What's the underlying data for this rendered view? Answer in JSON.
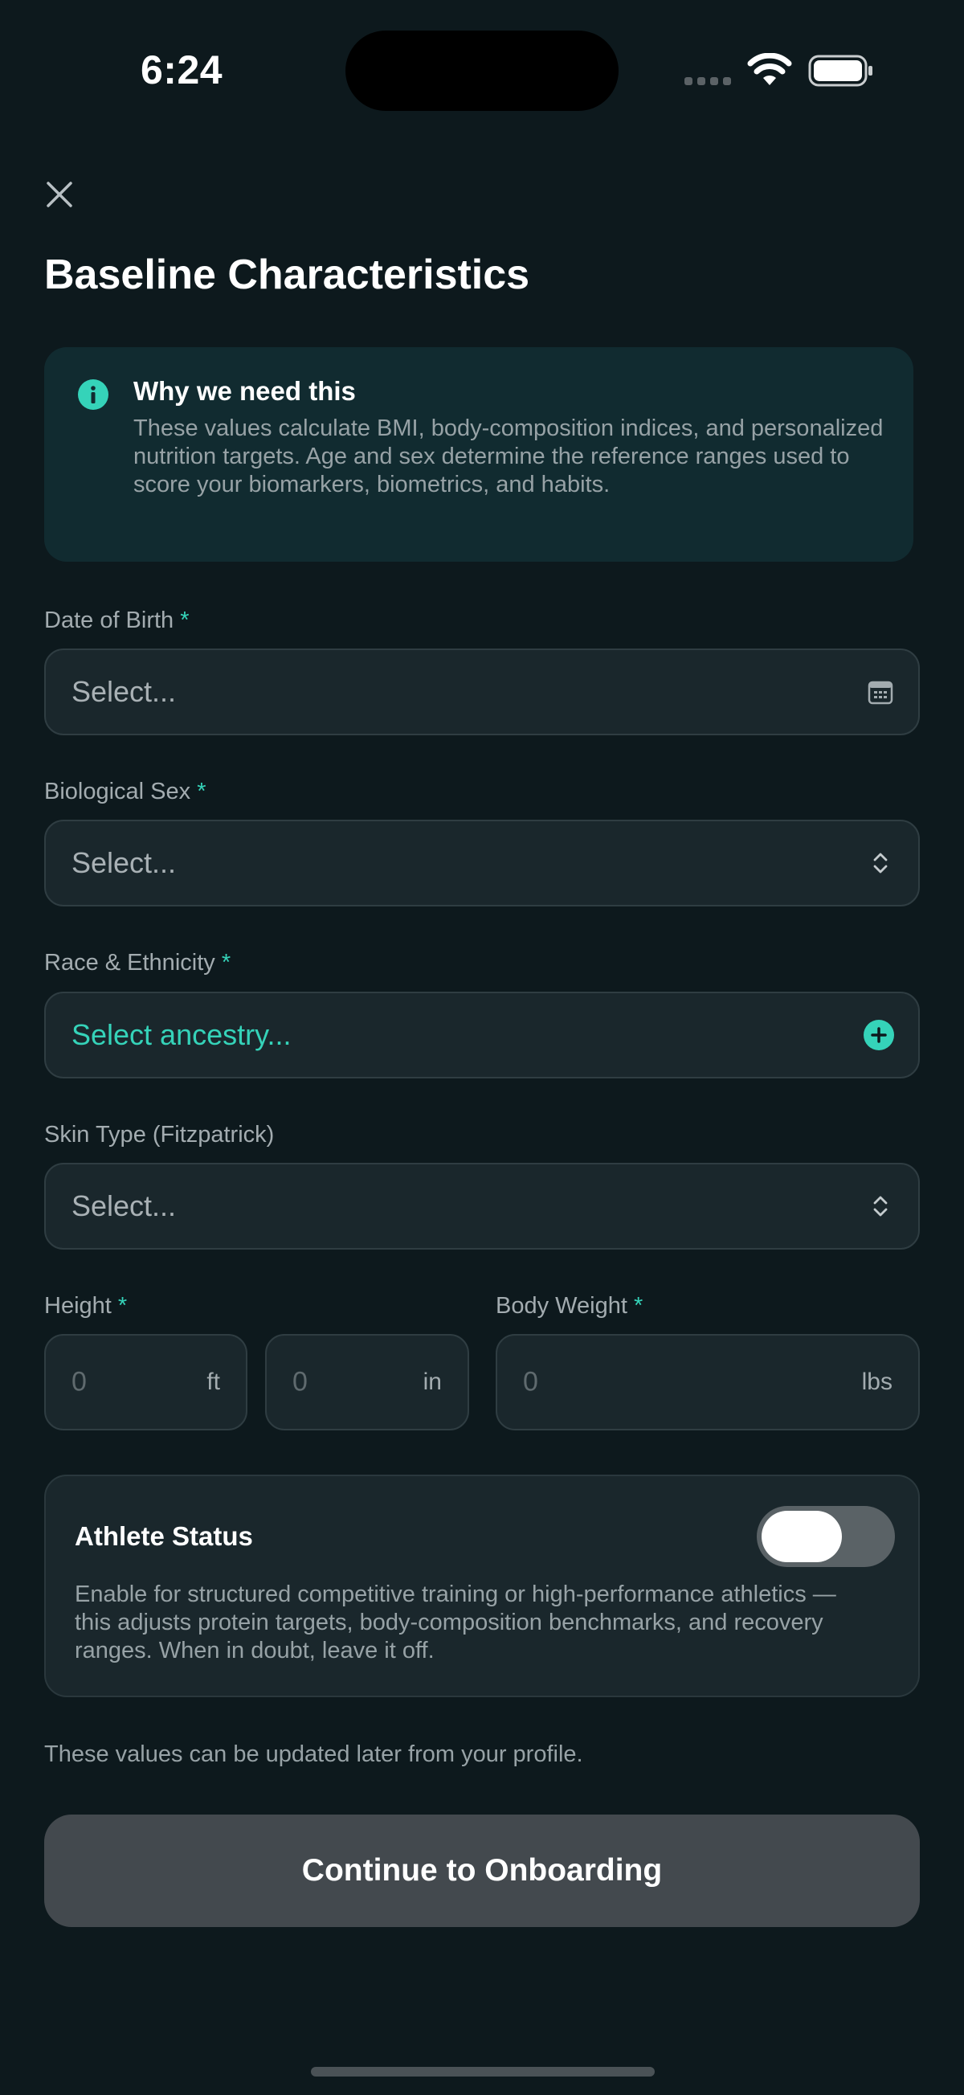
{
  "status_bar": {
    "time": "6:24",
    "icons": [
      "cellular-signal-icon",
      "wifi-icon",
      "battery-icon"
    ]
  },
  "header": {
    "close_icon": "close-icon",
    "title": "Baseline Characteristics"
  },
  "info_card": {
    "icon": "info-icon",
    "title": "Why we need this",
    "body": "These values calculate BMI, body-composition indices, and personalized nutrition targets. Age and sex determine the reference ranges used to score your biomarkers, biometrics, and habits."
  },
  "form": {
    "required_marker": "*",
    "dob": {
      "label": "Date of Birth",
      "placeholder": "Select...",
      "icon": "calendar-icon"
    },
    "sex": {
      "label": "Biological Sex",
      "placeholder": "Select...",
      "icon": "chevron-up-down-icon"
    },
    "race": {
      "label": "Race & Ethnicity",
      "placeholder": "Select ancestry...",
      "icon": "plus-circle-icon"
    },
    "skin": {
      "label": "Skin Type (Fitzpatrick)",
      "placeholder": "Select...",
      "icon": "chevron-up-down-icon"
    },
    "height": {
      "label": "Height",
      "feet_placeholder": "0",
      "feet_unit": "ft",
      "inches_placeholder": "0",
      "inches_unit": "in"
    },
    "weight": {
      "label": "Body Weight",
      "placeholder": "0",
      "unit": "lbs"
    }
  },
  "athlete": {
    "title": "Athlete Status",
    "toggle_on": false,
    "body": "Enable for structured competitive training or high-performance athletics — this adjusts protein targets, body-composition benchmarks, and recovery ranges. When in doubt, leave it off."
  },
  "footnote": "These values can be updated later from your profile.",
  "continue_button": {
    "label": "Continue to Onboarding"
  },
  "colors": {
    "background": "#0d191d",
    "accent": "#35d3b9",
    "card": "#1a272c",
    "info_card": "#112b30",
    "button": "#43494e"
  }
}
